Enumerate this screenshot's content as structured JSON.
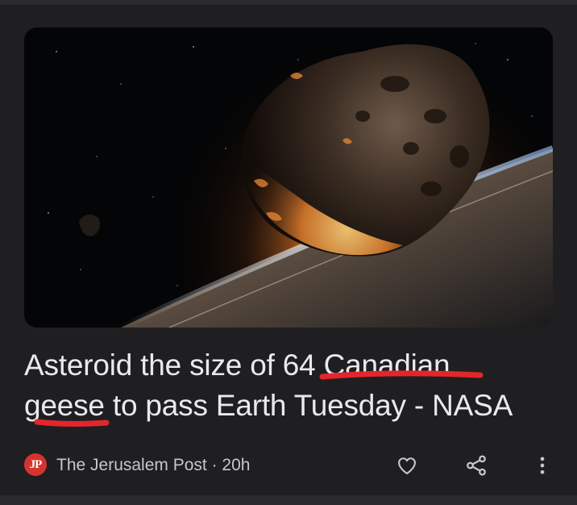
{
  "article": {
    "headline": "Asteroid the size of 64 Canadian geese to pass Earth Tuesday - NASA",
    "headline_line1_pre": "Asteroid the size of 64 ",
    "headline_line1_mark": "Canadian",
    "headline_line2_mark": "geese",
    "headline_line2_post": " to pass Earth Tuesday - NASA",
    "source_logo_text": "JP",
    "source": "The Jerusalem Post",
    "separator": " · ",
    "age": "20h",
    "source_line": "The Jerusalem Post · 20h"
  },
  "icons": {
    "save": "heart-icon",
    "share": "share-icon",
    "more": "more-vertical-icon"
  },
  "colors": {
    "background": "#1f1f21",
    "headline": "#e8eaed",
    "meta_text": "#c4c7cc",
    "annotation": "#e3262b",
    "source_logo": "#d7332e"
  }
}
